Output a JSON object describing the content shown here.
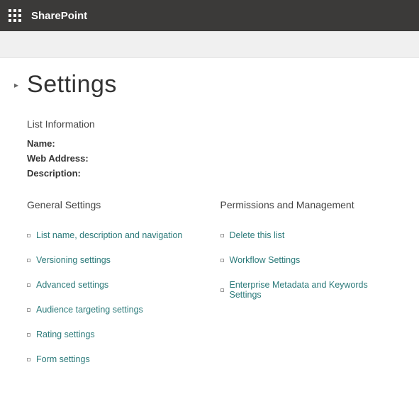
{
  "header": {
    "brand": "SharePoint"
  },
  "page": {
    "title": "Settings"
  },
  "listInfo": {
    "heading": "List Information",
    "nameLabel": "Name:",
    "webAddressLabel": "Web Address:",
    "descriptionLabel": "Description:"
  },
  "columns": {
    "general": {
      "heading": "General Settings",
      "links": [
        "List name, description and navigation",
        "Versioning settings",
        "Advanced settings",
        "Audience targeting settings",
        "Rating settings",
        "Form settings"
      ]
    },
    "permissions": {
      "heading": "Permissions and Management",
      "links": [
        "Delete this list",
        "Workflow Settings",
        "Enterprise Metadata and Keywords Settings"
      ]
    }
  }
}
